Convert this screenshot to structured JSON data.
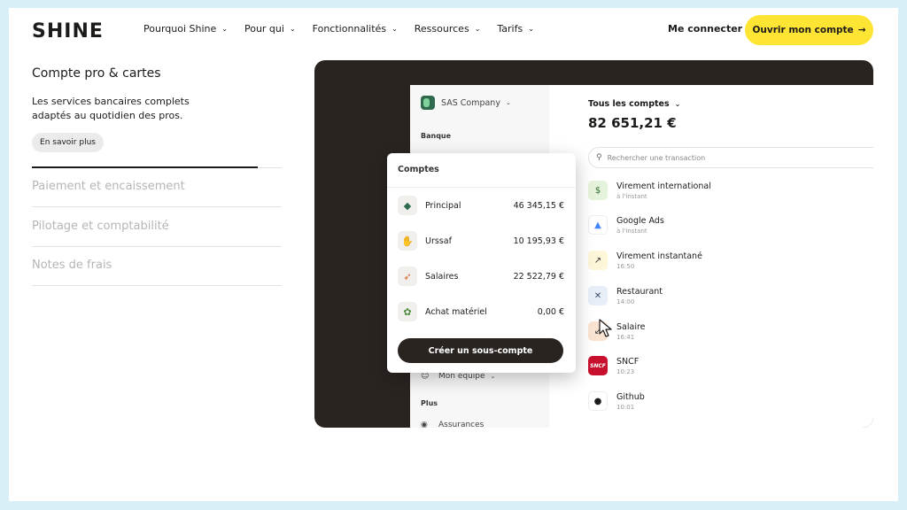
{
  "header": {
    "logo": "SHINE",
    "nav": [
      {
        "label": "Pourquoi Shine"
      },
      {
        "label": "Pour qui"
      },
      {
        "label": "Fonctionnalités"
      },
      {
        "label": "Ressources"
      },
      {
        "label": "Tarifs"
      }
    ],
    "login": "Me connecter",
    "cta": "Ouvrir mon compte",
    "cta_arrow": "→"
  },
  "left": {
    "title": "Compte pro & cartes",
    "description": "Les services bancaires complets adaptés au quotidien des pros.",
    "learn_more": "En savoir plus",
    "accordion": [
      {
        "label": "Paiement et encaissement"
      },
      {
        "label": "Pilotage et comptabilité"
      },
      {
        "label": "Notes de frais"
      }
    ]
  },
  "app": {
    "company": "SAS Company",
    "side": {
      "bank_label": "Banque",
      "team": "Mon équipe",
      "more_label": "Plus",
      "insurance": "Assurances"
    },
    "main": {
      "accounts_filter": "Tous les comptes",
      "balance": "82 651,21 €",
      "search_placeholder": "Rechercher une transaction",
      "transactions": [
        {
          "name": "Virement international",
          "time": "à l'instant",
          "icon": "dollar-icon",
          "glyph": "$",
          "bg": "#e6f3dc",
          "color": "#2f6a2f"
        },
        {
          "name": "Google Ads",
          "time": "à l'instant",
          "icon": "google-ads-icon",
          "glyph": "▲",
          "bg": "#ffffff",
          "color": "#4285f4"
        },
        {
          "name": "Virement instantané",
          "time": "16:50",
          "icon": "arrow-up-right-icon",
          "glyph": "↗",
          "bg": "#fdf6d8",
          "color": "#3a3a3a"
        },
        {
          "name": "Restaurant",
          "time": "14:00",
          "icon": "cutlery-icon",
          "glyph": "✕",
          "bg": "#e8eef7",
          "color": "#3a4a6a"
        },
        {
          "name": "Salaire",
          "time": "16:41",
          "icon": "arrow-down-left-icon",
          "glyph": "↙",
          "bg": "#fbe3d2",
          "color": "#3a3a3a"
        },
        {
          "name": "SNCF",
          "time": "10:23",
          "icon": "sncf-icon",
          "glyph": "SNCF",
          "bg": "#c8102e",
          "color": "#ffffff"
        },
        {
          "name": "Github",
          "time": "10:01",
          "icon": "github-icon",
          "glyph": "●",
          "bg": "#ffffff",
          "color": "#1d1b19"
        }
      ]
    },
    "popover": {
      "title": "Comptes",
      "accounts": [
        {
          "name": "Principal",
          "amount": "46 345,15 €",
          "icon": "wallet-icon",
          "glyph": "◆",
          "color": "#2f6a4e"
        },
        {
          "name": "Urssaf",
          "amount": "10 195,93 €",
          "icon": "hand-icon",
          "glyph": "✋",
          "color": "#e88a7a"
        },
        {
          "name": "Salaires",
          "amount": "22 522,79 €",
          "icon": "rocket-icon",
          "glyph": "➶",
          "color": "#d9602e"
        },
        {
          "name": "Achat matériel",
          "amount": "0,00 €",
          "icon": "plant-icon",
          "glyph": "✿",
          "color": "#4e8a3e"
        }
      ],
      "create_button": "Créer un sous-compte"
    }
  }
}
